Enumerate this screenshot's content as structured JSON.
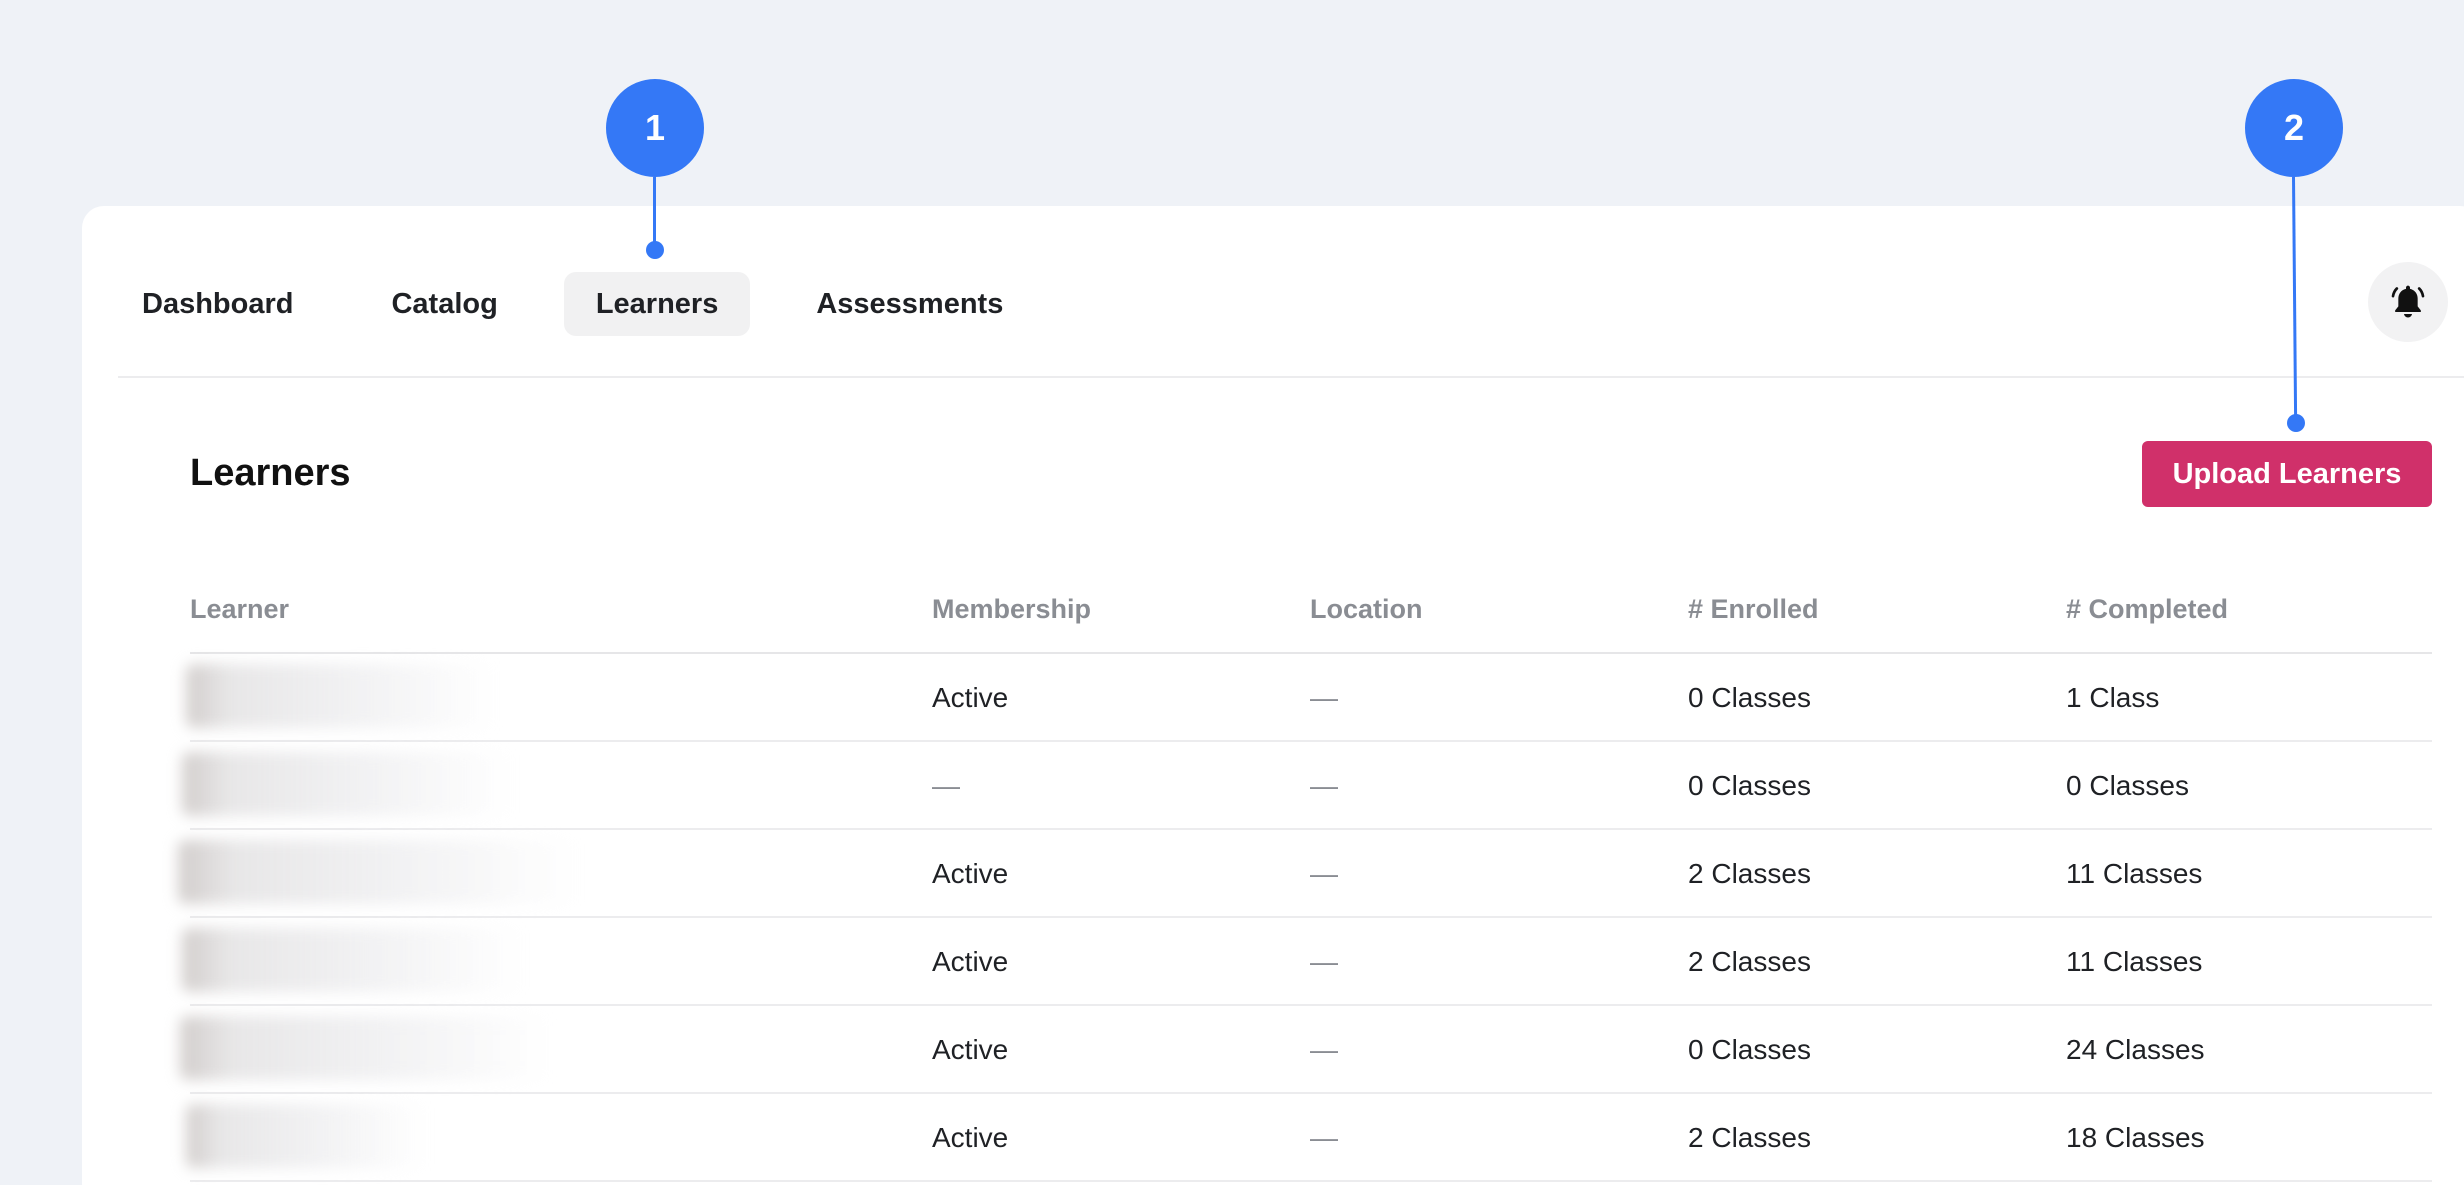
{
  "nav": {
    "tabs": [
      {
        "label": "Dashboard"
      },
      {
        "label": "Catalog"
      },
      {
        "label": "Learners"
      },
      {
        "label": "Assessments"
      }
    ],
    "active_tab": "Learners",
    "notification_icon": "bell-icon"
  },
  "page": {
    "title": "Learners",
    "upload_button_label": "Upload Learners"
  },
  "table": {
    "columns": [
      "Learner",
      "Membership",
      "Location",
      "# Enrolled",
      "# Completed"
    ],
    "rows": [
      {
        "learner": "",
        "membership": "Active",
        "location": "—",
        "enrolled": "0 Classes",
        "completed": "1 Class"
      },
      {
        "learner": "",
        "membership": "—",
        "location": "—",
        "enrolled": "0 Classes",
        "completed": "0 Classes"
      },
      {
        "learner": "",
        "membership": "Active",
        "location": "—",
        "enrolled": "2 Classes",
        "completed": "11 Classes"
      },
      {
        "learner": "",
        "membership": "Active",
        "location": "—",
        "enrolled": "2 Classes",
        "completed": "11 Classes"
      },
      {
        "learner": "",
        "membership": "Active",
        "location": "—",
        "enrolled": "0 Classes",
        "completed": "24 Classes"
      },
      {
        "learner": "",
        "membership": "Active",
        "location": "—",
        "enrolled": "2 Classes",
        "completed": "18 Classes"
      }
    ]
  },
  "annotations": {
    "markers": [
      "1",
      "2"
    ]
  },
  "colors": {
    "background": "#eff2f7",
    "primary_button": "#d0306a",
    "annotation_blue": "#3478f6",
    "active_tab_bg": "#f1f1f2"
  }
}
